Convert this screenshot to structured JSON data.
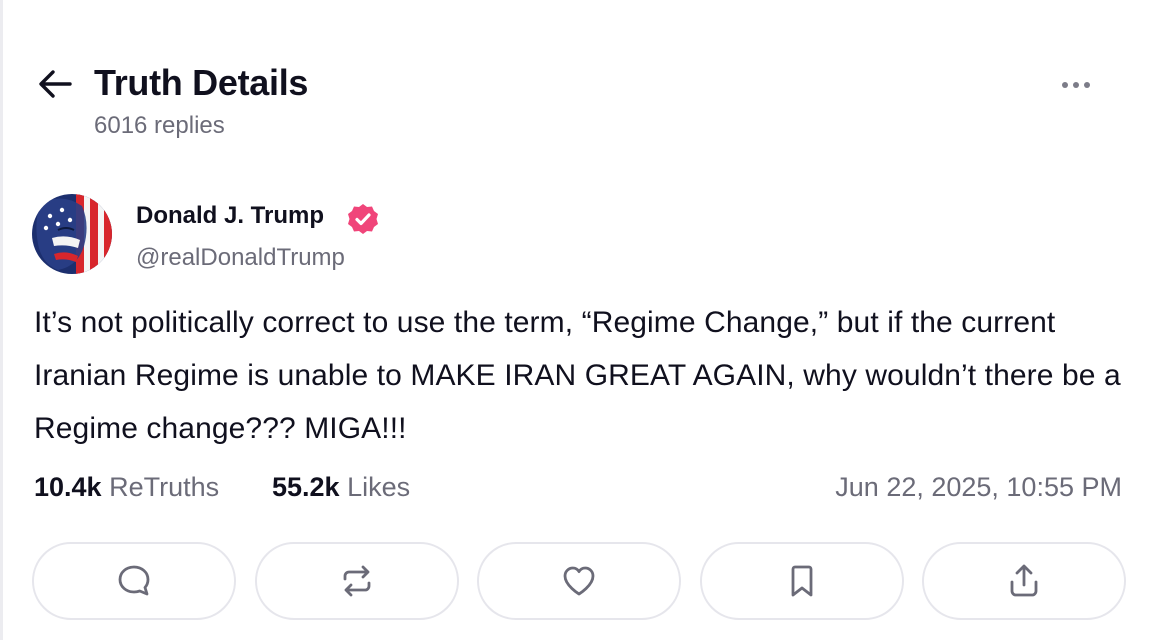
{
  "header": {
    "title": "Truth Details",
    "reply_count": "6016 replies",
    "back_icon": "arrow-left-icon",
    "more_icon": "ellipsis-icon"
  },
  "post": {
    "author_name": "Donald J. Trump",
    "handle": "@realDonaldTrump",
    "verified": true,
    "text": "It’s not politically correct to use the term, “Regime Change,” but if the current Iranian Regime is unable to MAKE IRAN GREAT AGAIN, why wouldn’t there be a Regime change??? MIGA!!!",
    "retruths_count": "10.4k",
    "retruths_label": "ReTruths",
    "likes_count": "55.2k",
    "likes_label": "Likes",
    "timestamp": "Jun 22, 2025, 10:55 PM"
  },
  "actions": [
    {
      "name": "reply-button",
      "icon": "comment-icon"
    },
    {
      "name": "retruth-button",
      "icon": "repost-icon"
    },
    {
      "name": "like-button",
      "icon": "heart-icon"
    },
    {
      "name": "bookmark-button",
      "icon": "bookmark-icon"
    },
    {
      "name": "share-button",
      "icon": "share-icon"
    }
  ],
  "colors": {
    "verified_badge": "#f0457a",
    "text_primary": "#10101e",
    "text_secondary": "#6b6b78",
    "button_border": "#e6e6ec"
  }
}
